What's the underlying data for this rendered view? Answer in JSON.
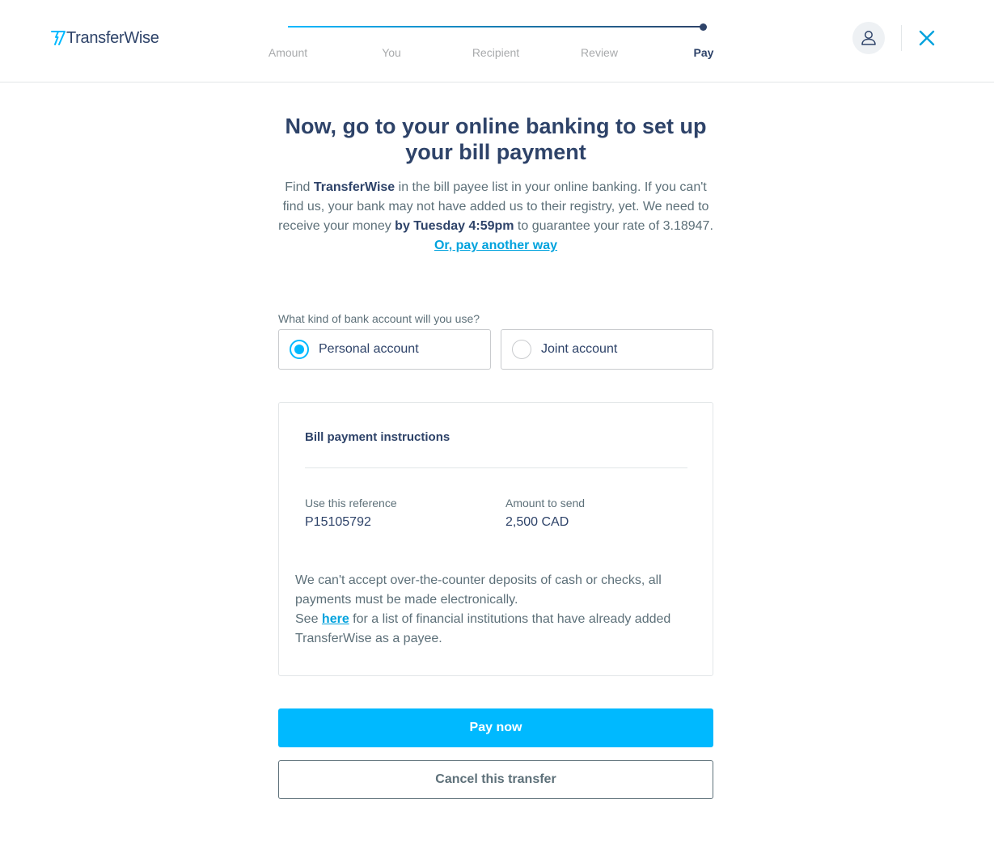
{
  "brand": {
    "name": "TransferWise",
    "primary_color": "#00b9ff",
    "navy_color": "#2e4369",
    "link_color": "#00a2dd"
  },
  "header": {
    "steps": [
      {
        "label": "Amount",
        "state": "done"
      },
      {
        "label": "You",
        "state": "done"
      },
      {
        "label": "Recipient",
        "state": "done"
      },
      {
        "label": "Review",
        "state": "done"
      },
      {
        "label": "Pay",
        "state": "active"
      }
    ],
    "progress": 1.0,
    "profile_icon": "user-icon",
    "close_icon": "close-icon"
  },
  "main": {
    "title": "Now, go to your online banking to set up your bill payment",
    "intro": {
      "part1": "Find ",
      "bold1": "TransferWise",
      "part2": " in the bill payee list in your online banking. If you can't find us, your bank may not have added us to their registry, yet. We need to receive your money ",
      "bold2": "by Tuesday 4:59pm",
      "part3": " to guarantee your rate of 3.18947."
    },
    "pay_other_link": "Or, pay another way"
  },
  "account_type": {
    "question": "What kind of bank account will you use?",
    "options": [
      {
        "label": "Personal account",
        "selected": true
      },
      {
        "label": "Joint account",
        "selected": false
      }
    ]
  },
  "instructions": {
    "title": "Bill payment instructions",
    "reference_label": "Use this reference",
    "reference_value": "P15105792",
    "amount_label": "Amount to send",
    "amount_value": "2,500 CAD",
    "note_line1": "We can't accept over-the-counter deposits of cash or checks, all payments must be made electronically.",
    "note_see": "See ",
    "note_link": "here",
    "note_rest": " for a list of financial institutions that have already added TransferWise as a payee."
  },
  "actions": {
    "primary": "Pay now",
    "secondary": "Cancel this transfer"
  }
}
